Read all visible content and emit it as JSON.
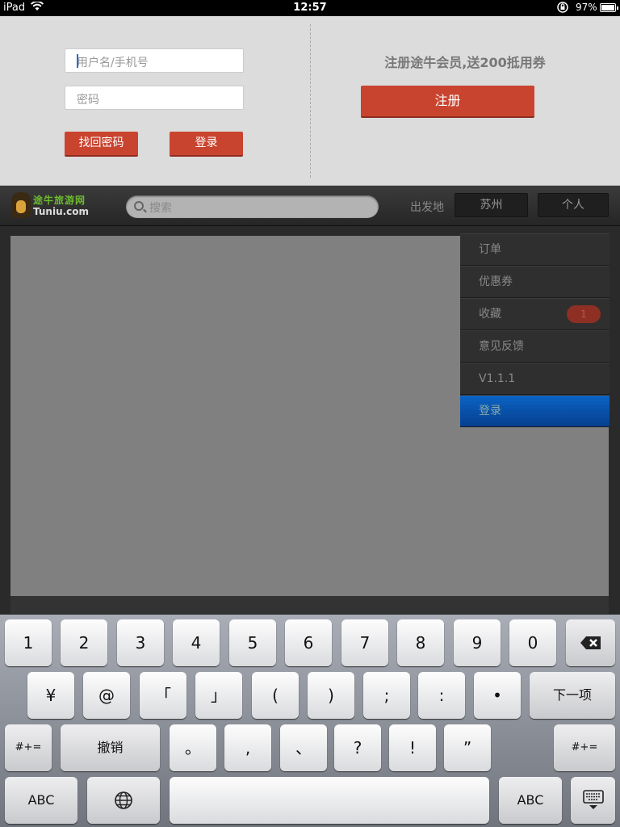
{
  "status_bar": {
    "carrier": "iPad",
    "time": "12:57",
    "battery": "97%",
    "battery_level": 0.97
  },
  "login": {
    "username_placeholder": "用户名/手机号",
    "password_placeholder": "密码",
    "forgot_label": "找回密码",
    "login_label": "登录",
    "promo_text": "注册途牛会员,送200抵用券",
    "register_label": "注册"
  },
  "navbar": {
    "logo_cn": "途牛旅游网",
    "logo_en": "Tuniu.com",
    "search_placeholder": "搜索",
    "depart_label": "出发地",
    "city": "苏州",
    "personal": "个人"
  },
  "menu": {
    "items": [
      {
        "label": "订单"
      },
      {
        "label": "优惠券"
      },
      {
        "label": "收藏",
        "badge": "1"
      },
      {
        "label": "意见反馈"
      },
      {
        "label": "V1.1.1"
      },
      {
        "label": "登录"
      }
    ]
  },
  "keyboard": {
    "row1": [
      "1",
      "2",
      "3",
      "4",
      "5",
      "6",
      "7",
      "8",
      "9",
      "0"
    ],
    "row2": [
      "¥",
      "@",
      "「",
      "」",
      "(",
      ")",
      ";",
      ":",
      "•"
    ],
    "next_label": "下一项",
    "row3_left": "#+=",
    "undo_label": "撤销",
    "row3": [
      "。",
      ",",
      "、",
      "?",
      "!",
      "”"
    ],
    "row3_right": "#+=",
    "abc_label": "ABC",
    "backspace_icon": "backspace-icon",
    "globe_icon": "globe-icon",
    "dismiss_icon": "keyboard-dismiss-icon"
  },
  "colors": {
    "accent_red": "#c9442f",
    "active_blue": "#0b63c4",
    "logo_green": "#6dbb2f"
  }
}
